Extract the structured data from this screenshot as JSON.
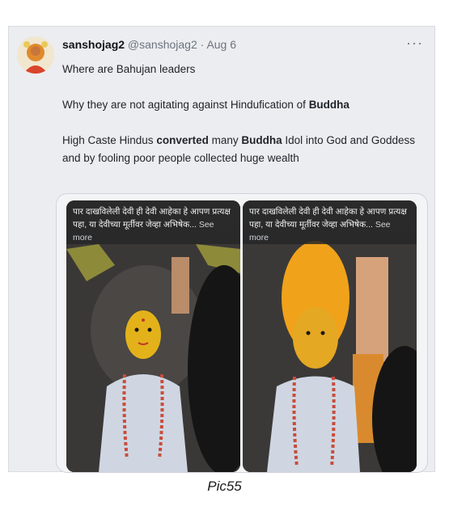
{
  "tweet": {
    "display_name": "sanshojag2",
    "handle": "@sanshojag2",
    "separator": "·",
    "date": "Aug 6",
    "more_icon": "more-horizontal-icon",
    "lines": {
      "l1": "Where are Bahujan leaders",
      "l2_pre": "Why they are not agitating against Hindufication of ",
      "l2_bold": "Buddha",
      "l3_pre": "High Caste Hindus ",
      "l3_bold1": "converted",
      "l3_mid": " many ",
      "l3_bold2": "Buddha",
      "l3_post": " Idol into God and Goddess",
      "l4": "and by fooling poor people collected huge wealth"
    }
  },
  "media": [
    {
      "overlay_line1": "पार दाखविलेली देवी ही देवी आहेका हे आपण प्रत्यक्ष",
      "overlay_line2": "पहा, या देवीच्या मूर्तीवर जेव्हा अभिषेक...",
      "see_more": "See more"
    },
    {
      "overlay_line1": "पार दाखविलेली देवी ही देवी आहेका हे आपण प्रत्यक्ष",
      "overlay_line2": "पहा, या देवीच्या मूर्तीवर जेव्हा अभिषेक...",
      "see_more": "See more"
    }
  ],
  "caption": "Pic55"
}
